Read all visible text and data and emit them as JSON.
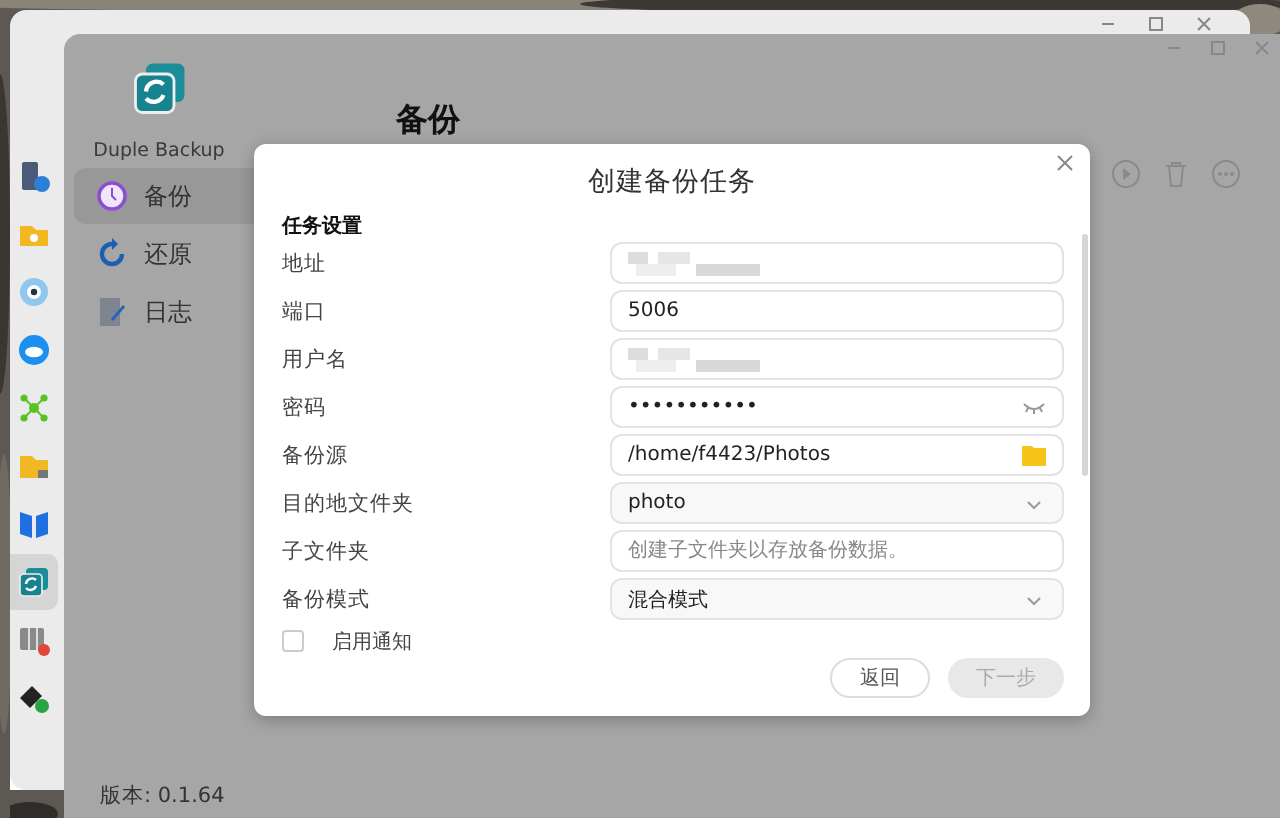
{
  "dock": [
    {
      "selected": false
    },
    {
      "selected": false
    },
    {
      "selected": false
    },
    {
      "selected": false
    },
    {
      "selected": false
    },
    {
      "selected": false
    },
    {
      "selected": false
    },
    {
      "selected": true
    },
    {
      "selected": false
    },
    {
      "selected": false
    }
  ],
  "app": {
    "name": "Duple Backup",
    "page_title": "备份",
    "version": "版本: 0.1.64",
    "nav": [
      {
        "label": "备份",
        "selected": true
      },
      {
        "label": "还原",
        "selected": false
      },
      {
        "label": "日志",
        "selected": false
      }
    ]
  },
  "dialog": {
    "title": "创建备份任务",
    "section": "任务设置",
    "fields": [
      {
        "label": "地址",
        "kind": "blurred"
      },
      {
        "label": "端口",
        "kind": "text",
        "value": "5006"
      },
      {
        "label": "用户名",
        "kind": "blurred"
      },
      {
        "label": "密码",
        "kind": "password",
        "value": "•••••••••••"
      },
      {
        "label": "备份源",
        "kind": "folder",
        "value": "/home/f4423/Photos"
      },
      {
        "label": "目的地文件夹",
        "kind": "select",
        "value": "photo"
      },
      {
        "label": "子文件夹",
        "kind": "text",
        "placeholder": "创建子文件夹以存放备份数据。"
      },
      {
        "label": "备份模式",
        "kind": "select",
        "value": "混合模式"
      }
    ],
    "notify": {
      "label": "启用通知",
      "checked": false
    },
    "buttons": [
      {
        "label": "返回",
        "disabled": false
      },
      {
        "label": "下一步",
        "disabled": true
      }
    ]
  }
}
